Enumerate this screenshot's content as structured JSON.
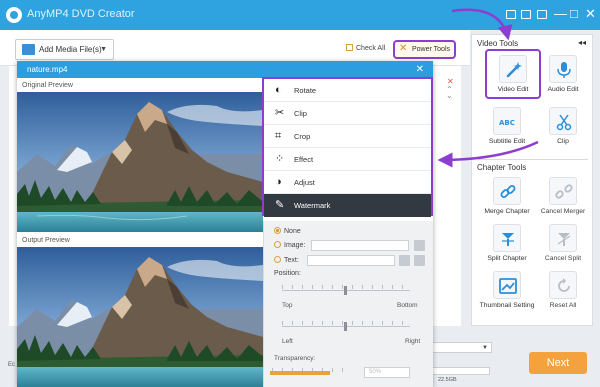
{
  "app": {
    "title": "AnyMP4 DVD Creator"
  },
  "window_controls": [
    "—",
    "□",
    "✕"
  ],
  "toolbar": {
    "add_media_label": "Add Media File(s)",
    "check_all_label": "Check All",
    "power_tools_label": "Power Tools"
  },
  "dialog": {
    "title": "nature.mp4",
    "original_preview_label": "Original Preview",
    "output_preview_label": "Output Preview"
  },
  "edit_menu": {
    "items": [
      {
        "label": "Rotate",
        "icon": "rotate-icon"
      },
      {
        "label": "Clip",
        "icon": "scissors-icon"
      },
      {
        "label": "Crop",
        "icon": "crop-icon"
      },
      {
        "label": "Effect",
        "icon": "effect-icon"
      },
      {
        "label": "Adjust",
        "icon": "adjust-icon"
      },
      {
        "label": "Watermark",
        "icon": "brush-icon"
      }
    ],
    "selected": "Watermark"
  },
  "watermark": {
    "options": [
      {
        "label": "None",
        "selected": true
      },
      {
        "label": "Image:",
        "selected": false
      },
      {
        "label": "Text:",
        "selected": false
      }
    ],
    "position_label": "Position:",
    "top_label": "Top",
    "bottom_label": "Bottom",
    "left_label": "Left",
    "right_label": "Right",
    "transparency_label": "Transparency:",
    "transparency_value": "50%"
  },
  "right_panel": {
    "video_tools_title": "Video Tools",
    "chapter_tools_title": "Chapter Tools",
    "video_tools": [
      {
        "label": "Video Edit",
        "icon": "magic-wand-icon",
        "highlighted": true
      },
      {
        "label": "Audio Edit",
        "icon": "microphone-icon"
      },
      {
        "label": "Subtitle Edit",
        "icon": "subtitle-icon"
      },
      {
        "label": "Clip",
        "icon": "scissors-icon"
      }
    ],
    "chapter_tools": [
      {
        "label": "Merge Chapter",
        "icon": "chain-link-icon"
      },
      {
        "label": "Cancel Merger",
        "icon": "broken-link-icon"
      },
      {
        "label": "Split Chapter",
        "icon": "split-icon"
      },
      {
        "label": "Cancel Split",
        "icon": "cancel-split-icon"
      },
      {
        "label": "Thumbnail Setting",
        "icon": "thumbnail-icon"
      },
      {
        "label": "Reset All",
        "icon": "reset-icon"
      }
    ]
  },
  "bottom": {
    "left_text": "Ec",
    "storage_text": "22.5GB",
    "next_label": "Next"
  },
  "colors": {
    "accent_blue": "#2ea3e0",
    "highlight_purple": "#8d3ecf",
    "next_orange": "#f4a23d",
    "menu_active": "#333941"
  }
}
